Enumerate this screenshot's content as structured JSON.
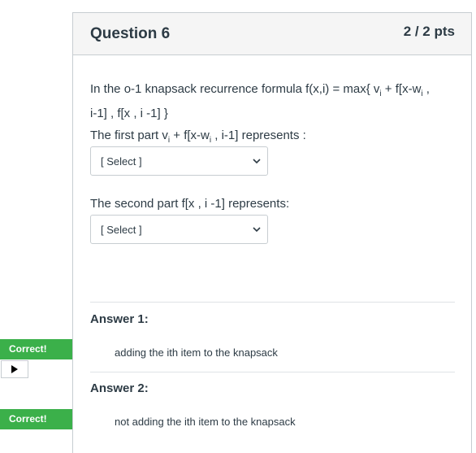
{
  "question": {
    "title": "Question 6",
    "points": "2 / 2 pts",
    "text": {
      "line1_pre": "In the o-1 knapsack recurrence formula f(x,i) = max{ v",
      "line1_sub1": "i",
      "line1_mid": " + f[x-w",
      "line1_sub2": "i",
      "line1_post": " ,",
      "line2": "i-1] , f[x , i -1] }"
    },
    "prompt1": {
      "pre": "The first part v",
      "sub1": "i",
      "mid": " + f[x-w",
      "sub2": "i",
      "post": " , i-1] represents :"
    },
    "select1": {
      "value": "[ Select ]"
    },
    "prompt2": "The second part f[x , i -1] represents:",
    "select2": {
      "value": "[ Select ]"
    }
  },
  "answers": [
    {
      "label": "Answer 1:",
      "badge": "Correct!",
      "text": "adding the ith item to the knapsack"
    },
    {
      "label": "Answer 2:",
      "badge": "Correct!",
      "text": "not adding the ith item to the knapsack"
    }
  ],
  "icons": {
    "select_chevron": "chevron-down-icon",
    "play": "play-icon"
  },
  "colors": {
    "correct_badge": "#3bb04a",
    "header_bg": "#f5f5f5",
    "border": "#c7cdd1",
    "text": "#2d3b45"
  }
}
